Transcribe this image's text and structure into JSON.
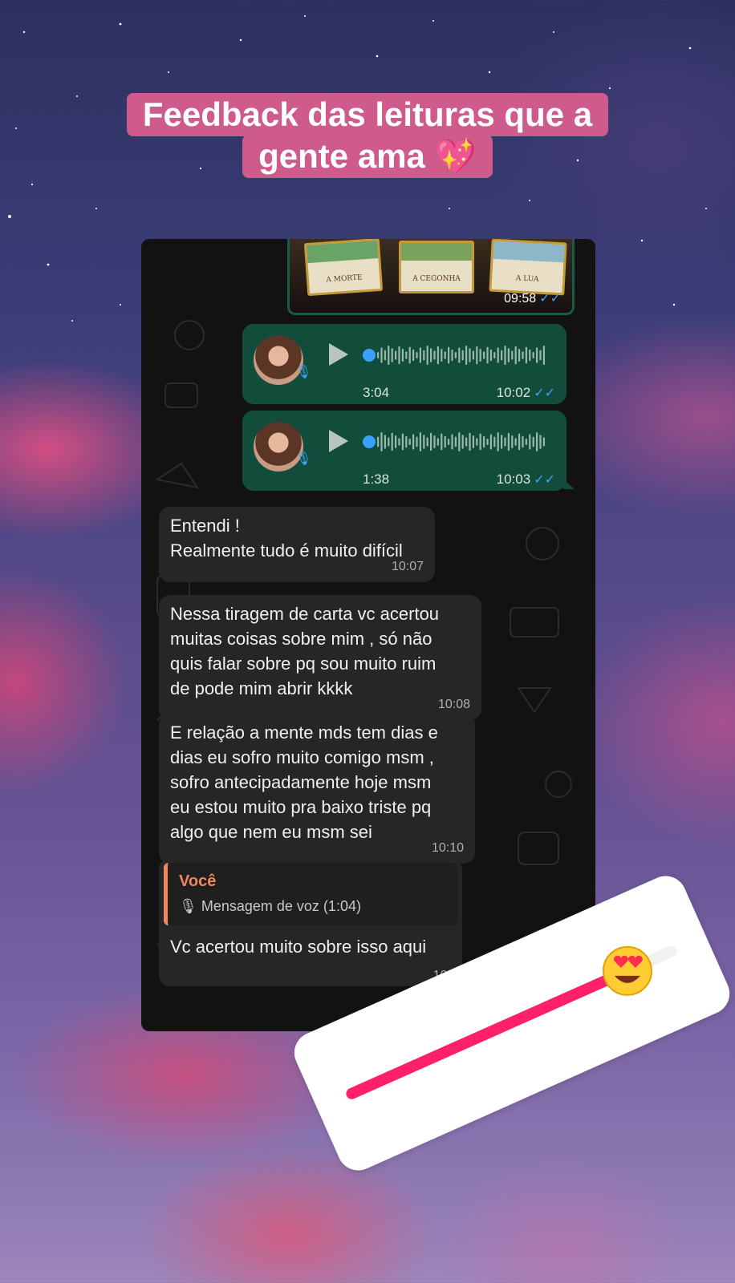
{
  "headline": {
    "line1": "Feedback das leituras que a",
    "line2": "gente ama 💖"
  },
  "chat": {
    "image_message": {
      "cards": [
        "A MORTE",
        "A CEGONHA",
        "A LUA"
      ],
      "time": "09:58"
    },
    "voice_messages": [
      {
        "duration": "3:04",
        "time": "10:02"
      },
      {
        "duration": "1:38",
        "time": "10:03"
      }
    ],
    "incoming": [
      {
        "text": "Entendi !\nRealmente tudo é muito difícil",
        "time": "10:07"
      },
      {
        "text": "Nessa tiragem de carta vc acertou\nmuitas coisas sobre mim , só não\nquis falar sobre pq sou muito ruim\nde pode mim abrir kkkk",
        "time": "10:08"
      },
      {
        "text": "E relação a mente mds tem dias e\ndias eu sofro muito comigo msm ,\nsofro antecipadamente hoje msm\neu estou muito pra baixo triste pq\nalgo que nem eu msm sei",
        "time": "10:10"
      }
    ],
    "reply": {
      "quote_author": "Você",
      "quote_text": "Mensagem de voz (1:04)",
      "text": "Vc acertou muito sobre isso aqui",
      "time": "10:"
    }
  },
  "slider_sticker": {
    "emoji": "😍",
    "value_fraction": 0.85,
    "fill_color": "#ff1f6b"
  },
  "colors": {
    "headline_bg": "#cf5b8c",
    "outgoing_bubble": "#114d3a",
    "incoming_bubble": "#262626",
    "read_tick": "#3ba1ff",
    "quote_accent": "#f0885a"
  }
}
